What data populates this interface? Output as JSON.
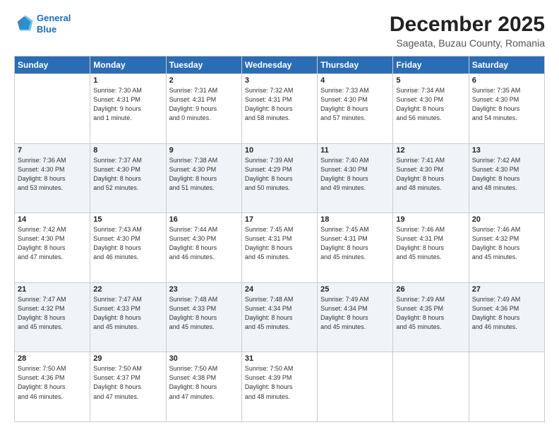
{
  "header": {
    "logo_line1": "General",
    "logo_line2": "Blue",
    "title": "December 2025",
    "subtitle": "Sageata, Buzau County, Romania"
  },
  "weekdays": [
    "Sunday",
    "Monday",
    "Tuesday",
    "Wednesday",
    "Thursday",
    "Friday",
    "Saturday"
  ],
  "weeks": [
    [
      {
        "day": "",
        "info": ""
      },
      {
        "day": "1",
        "info": "Sunrise: 7:30 AM\nSunset: 4:31 PM\nDaylight: 9 hours\nand 1 minute."
      },
      {
        "day": "2",
        "info": "Sunrise: 7:31 AM\nSunset: 4:31 PM\nDaylight: 9 hours\nand 0 minutes."
      },
      {
        "day": "3",
        "info": "Sunrise: 7:32 AM\nSunset: 4:31 PM\nDaylight: 8 hours\nand 58 minutes."
      },
      {
        "day": "4",
        "info": "Sunrise: 7:33 AM\nSunset: 4:30 PM\nDaylight: 8 hours\nand 57 minutes."
      },
      {
        "day": "5",
        "info": "Sunrise: 7:34 AM\nSunset: 4:30 PM\nDaylight: 8 hours\nand 56 minutes."
      },
      {
        "day": "6",
        "info": "Sunrise: 7:35 AM\nSunset: 4:30 PM\nDaylight: 8 hours\nand 54 minutes."
      }
    ],
    [
      {
        "day": "7",
        "info": "Sunrise: 7:36 AM\nSunset: 4:30 PM\nDaylight: 8 hours\nand 53 minutes."
      },
      {
        "day": "8",
        "info": "Sunrise: 7:37 AM\nSunset: 4:30 PM\nDaylight: 8 hours\nand 52 minutes."
      },
      {
        "day": "9",
        "info": "Sunrise: 7:38 AM\nSunset: 4:30 PM\nDaylight: 8 hours\nand 51 minutes."
      },
      {
        "day": "10",
        "info": "Sunrise: 7:39 AM\nSunset: 4:29 PM\nDaylight: 8 hours\nand 50 minutes."
      },
      {
        "day": "11",
        "info": "Sunrise: 7:40 AM\nSunset: 4:30 PM\nDaylight: 8 hours\nand 49 minutes."
      },
      {
        "day": "12",
        "info": "Sunrise: 7:41 AM\nSunset: 4:30 PM\nDaylight: 8 hours\nand 48 minutes."
      },
      {
        "day": "13",
        "info": "Sunrise: 7:42 AM\nSunset: 4:30 PM\nDaylight: 8 hours\nand 48 minutes."
      }
    ],
    [
      {
        "day": "14",
        "info": "Sunrise: 7:42 AM\nSunset: 4:30 PM\nDaylight: 8 hours\nand 47 minutes."
      },
      {
        "day": "15",
        "info": "Sunrise: 7:43 AM\nSunset: 4:30 PM\nDaylight: 8 hours\nand 46 minutes."
      },
      {
        "day": "16",
        "info": "Sunrise: 7:44 AM\nSunset: 4:30 PM\nDaylight: 8 hours\nand 46 minutes."
      },
      {
        "day": "17",
        "info": "Sunrise: 7:45 AM\nSunset: 4:31 PM\nDaylight: 8 hours\nand 45 minutes."
      },
      {
        "day": "18",
        "info": "Sunrise: 7:45 AM\nSunset: 4:31 PM\nDaylight: 8 hours\nand 45 minutes."
      },
      {
        "day": "19",
        "info": "Sunrise: 7:46 AM\nSunset: 4:31 PM\nDaylight: 8 hours\nand 45 minutes."
      },
      {
        "day": "20",
        "info": "Sunrise: 7:46 AM\nSunset: 4:32 PM\nDaylight: 8 hours\nand 45 minutes."
      }
    ],
    [
      {
        "day": "21",
        "info": "Sunrise: 7:47 AM\nSunset: 4:32 PM\nDaylight: 8 hours\nand 45 minutes."
      },
      {
        "day": "22",
        "info": "Sunrise: 7:47 AM\nSunset: 4:33 PM\nDaylight: 8 hours\nand 45 minutes."
      },
      {
        "day": "23",
        "info": "Sunrise: 7:48 AM\nSunset: 4:33 PM\nDaylight: 8 hours\nand 45 minutes."
      },
      {
        "day": "24",
        "info": "Sunrise: 7:48 AM\nSunset: 4:34 PM\nDaylight: 8 hours\nand 45 minutes."
      },
      {
        "day": "25",
        "info": "Sunrise: 7:49 AM\nSunset: 4:34 PM\nDaylight: 8 hours\nand 45 minutes."
      },
      {
        "day": "26",
        "info": "Sunrise: 7:49 AM\nSunset: 4:35 PM\nDaylight: 8 hours\nand 45 minutes."
      },
      {
        "day": "27",
        "info": "Sunrise: 7:49 AM\nSunset: 4:36 PM\nDaylight: 8 hours\nand 46 minutes."
      }
    ],
    [
      {
        "day": "28",
        "info": "Sunrise: 7:50 AM\nSunset: 4:36 PM\nDaylight: 8 hours\nand 46 minutes."
      },
      {
        "day": "29",
        "info": "Sunrise: 7:50 AM\nSunset: 4:37 PM\nDaylight: 8 hours\nand 47 minutes."
      },
      {
        "day": "30",
        "info": "Sunrise: 7:50 AM\nSunset: 4:38 PM\nDaylight: 8 hours\nand 47 minutes."
      },
      {
        "day": "31",
        "info": "Sunrise: 7:50 AM\nSunset: 4:39 PM\nDaylight: 8 hours\nand 48 minutes."
      },
      {
        "day": "",
        "info": ""
      },
      {
        "day": "",
        "info": ""
      },
      {
        "day": "",
        "info": ""
      }
    ]
  ]
}
